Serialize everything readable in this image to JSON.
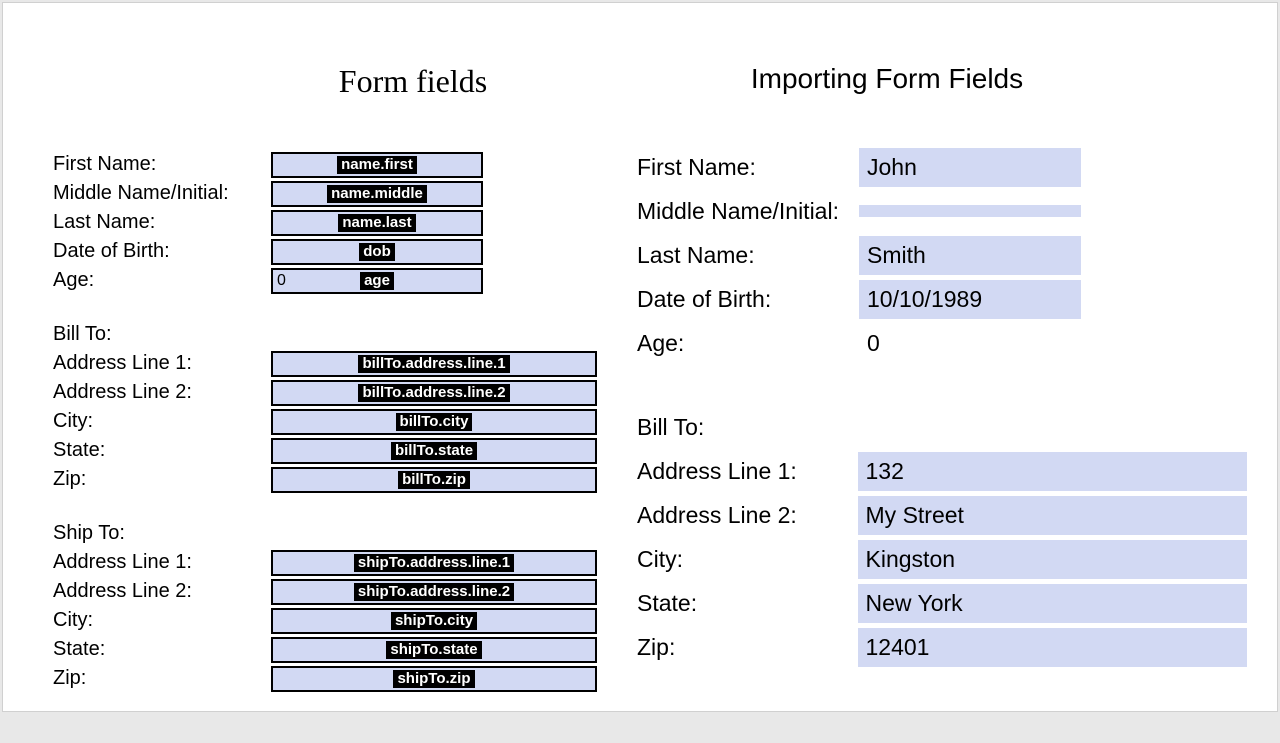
{
  "left": {
    "title": "Form fields",
    "name": {
      "first_label": "First Name:",
      "first_tag": "name.first",
      "middle_label": "Middle Name/Initial:",
      "middle_tag": "name.middle",
      "last_label": "Last Name:",
      "last_tag": "name.last",
      "dob_label": "Date of Birth:",
      "dob_tag": "dob",
      "age_label": "Age:",
      "age_tag": "age",
      "age_zero": "0"
    },
    "billto": {
      "section_label": "Bill To:",
      "addr1_label": "Address Line 1:",
      "addr1_tag": "billTo.address.line.1",
      "addr2_label": "Address Line 2:",
      "addr2_tag": "billTo.address.line.2",
      "city_label": "City:",
      "city_tag": "billTo.city",
      "state_label": "State:",
      "state_tag": "billTo.state",
      "zip_label": "Zip:",
      "zip_tag": "billTo.zip"
    },
    "shipto": {
      "section_label": "Ship To:",
      "addr1_label": "Address Line 1:",
      "addr1_tag": "shipTo.address.line.1",
      "addr2_label": "Address Line 2:",
      "addr2_tag": "shipTo.address.line.2",
      "city_label": "City:",
      "city_tag": "shipTo.city",
      "state_label": "State:",
      "state_tag": "shipTo.state",
      "zip_label": "Zip:",
      "zip_tag": "shipTo.zip"
    }
  },
  "right": {
    "title": "Importing Form Fields",
    "first_label": "First Name:",
    "first_value": "John",
    "middle_label": "Middle Name/Initial:",
    "middle_value": "",
    "last_label": "Last Name:",
    "last_value": "Smith",
    "dob_label": "Date of Birth:",
    "dob_value": "10/10/1989",
    "age_label": "Age:",
    "age_value": "0",
    "billto_section": "Bill To:",
    "addr1_label": "Address Line 1:",
    "addr1_value": "132",
    "addr2_label": "Address Line 2:",
    "addr2_value": "My Street",
    "city_label": "City:",
    "city_value": "Kingston",
    "state_label": "State:",
    "state_value": "New York",
    "zip_label": "Zip:",
    "zip_value": "12401"
  }
}
